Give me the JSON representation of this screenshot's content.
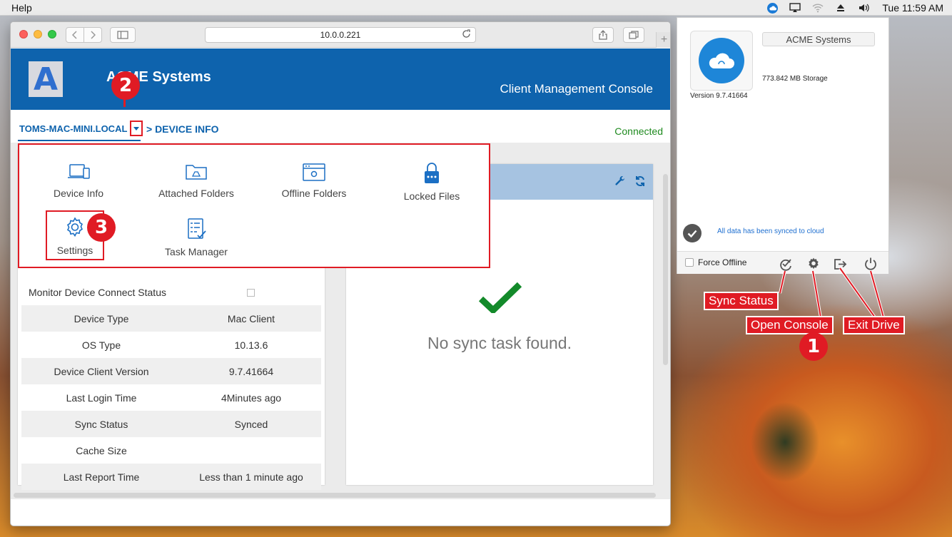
{
  "menubar": {
    "help": "Help",
    "clock": "Tue 11:59 AM"
  },
  "browser": {
    "url": "10.0.0.221"
  },
  "header": {
    "brand": "ACME Systems",
    "logo_letter": "A",
    "console_title": "Client Management Console"
  },
  "breadcrumb": {
    "host": "TOMS-MAC-MINI.LOCAL",
    "page": "> DEVICE INFO",
    "status": "Connected"
  },
  "menu": {
    "items": [
      {
        "label": "Device Info",
        "icon": "laptop-icon"
      },
      {
        "label": "Attached Folders",
        "icon": "folder-icon"
      },
      {
        "label": "Offline Folders",
        "icon": "offline-folder-icon"
      },
      {
        "label": "Locked Files",
        "icon": "lock-icon"
      },
      {
        "label": "Settings",
        "icon": "gear-icon"
      },
      {
        "label": "Task Manager",
        "icon": "checklist-icon"
      }
    ]
  },
  "device": {
    "monitor_label": "Monitor Device Connect Status",
    "rows": [
      {
        "key": "Device Type",
        "value": "Mac Client"
      },
      {
        "key": "OS Type",
        "value": "10.13.6"
      },
      {
        "key": "Device Client Version",
        "value": "9.7.41664"
      },
      {
        "key": "Last Login Time",
        "value": "4Minutes ago"
      },
      {
        "key": "Sync Status",
        "value": "Synced"
      },
      {
        "key": "Cache Size",
        "value": ""
      },
      {
        "key": "Last Report Time",
        "value": "Less than 1 minute ago"
      }
    ]
  },
  "sync_panel": {
    "empty_text": "No sync task found."
  },
  "app": {
    "company": "ACME Systems",
    "version": "Version 9.7.41664",
    "storage": "773.842 MB Storage",
    "synced_text": "All data has been synced to cloud",
    "force_offline": "Force Offline"
  },
  "annotations": {
    "badge1": "1",
    "badge2": "2",
    "badge3": "3",
    "sync_status": "Sync Status",
    "open_console": "Open Console",
    "exit_drive": "Exit Drive"
  },
  "colors": {
    "brand_blue": "#0e63ad",
    "annotation_red": "#e01b24",
    "connected_green": "#1f8a1f"
  }
}
